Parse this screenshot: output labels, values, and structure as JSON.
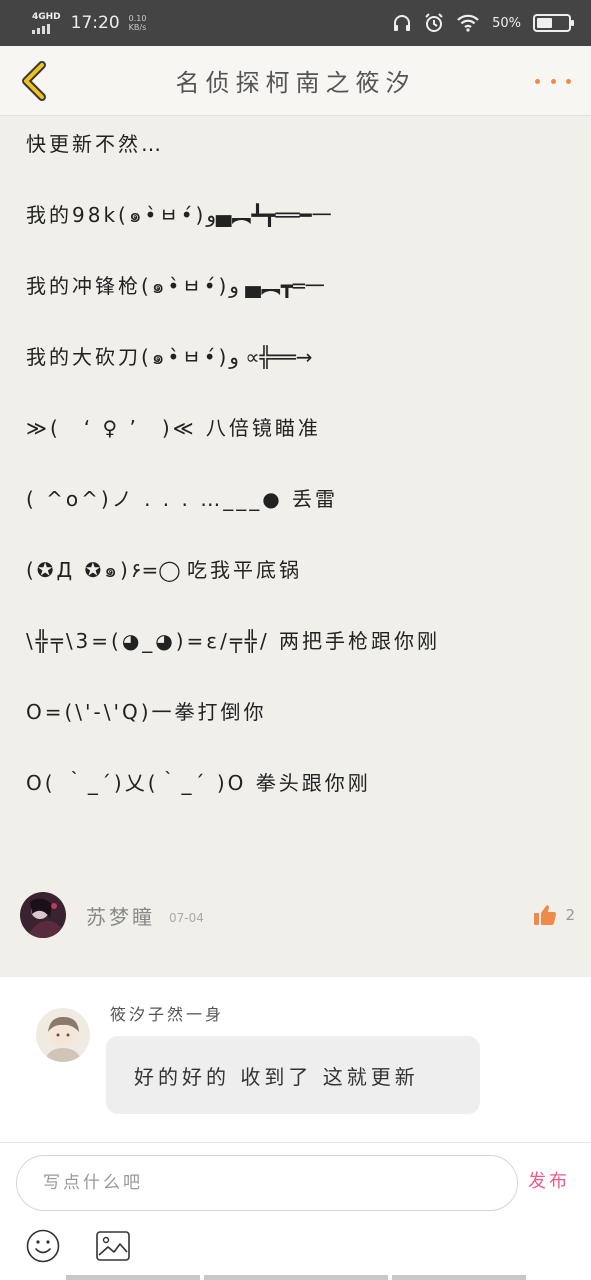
{
  "status_bar": {
    "network": "4GHD",
    "time": "17:20",
    "speed_value": "0.10",
    "speed_unit": "KB/s",
    "battery_text": "50%",
    "battery_level": 0.5
  },
  "header": {
    "title": "名侦探柯南之筱汐"
  },
  "post": {
    "lines": [
      "快更新不然…",
      "我的98k(๑•̀ㅂ•́)و▄︻┻┳══━一",
      "我的冲锋枪(๑•̀ㅂ•́)و ▄︻┳═一",
      "我的大砍刀(๑•̀ㅂ•́)و ∝╬══→",
      "≫(　‘ ♀ ’　)≪ 八倍镜瞄准",
      "( ^o^)ノ . . .  …___● 丢雷",
      "(✪Д ✪๑)۶=◯ 吃我平底锅",
      "\\╬╤\\3=(◕_◕)=ε/╤╬/ 两把手枪跟你刚",
      "O=(\\'-\\'Q)一拳打倒你",
      " O( ｀_´)乂(｀_´ )O 拳头跟你刚"
    ],
    "author": {
      "name": "苏梦瞳",
      "date": "07-04",
      "likes": "2"
    }
  },
  "reply": {
    "name": "筱汐子然一身",
    "text": "好的好的 收到了 这就更新"
  },
  "input": {
    "placeholder": "写点什么吧",
    "value": "",
    "publish_label": "发布"
  },
  "colors": {
    "accent_orange": "#f08a4b",
    "publish_pink": "#f25a8a",
    "status_bar_bg": "#444444",
    "content_bg": "#f0efea"
  },
  "icons": {
    "back": "chevron-left-icon",
    "more": "more-dots-icon",
    "like": "thumbs-up-icon",
    "emoji": "smiley-icon",
    "image": "image-icon"
  }
}
